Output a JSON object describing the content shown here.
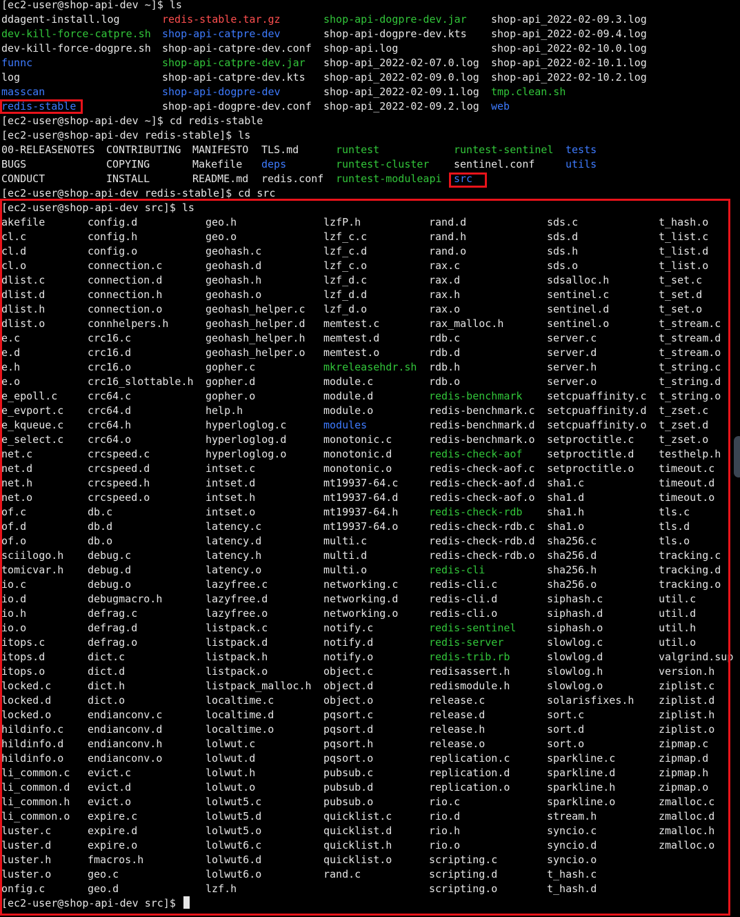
{
  "colors": {
    "background": "#000000",
    "text": "#e6e6e6",
    "executable": "#32c63a",
    "directory": "#3e7bff",
    "archive": "#ff4f4f",
    "highlight": "#e8131a"
  },
  "listing1": {
    "prompt": "[ec2-user@shop-api-dev ~]$ ls",
    "rows": [
      [
        "ddagent-install.log",
        "redis-stable.tar.gz",
        "shop-api-dogpre-dev.jar",
        "shop-api_2022-02-09.3.log"
      ],
      [
        "dev-kill-force-catpre.sh",
        "shop-api-catpre-dev",
        "shop-api-dogpre-dev.kts",
        "shop-api_2022-02-09.4.log"
      ],
      [
        "dev-kill-force-dogpre.sh",
        "shop-api-catpre-dev.conf",
        "shop-api.log",
        "shop-api_2022-02-10.0.log"
      ],
      [
        "funnc",
        "shop-api-catpre-dev.jar",
        "shop-api_2022-02-07.0.log",
        "shop-api_2022-02-10.1.log"
      ],
      [
        "log",
        "shop-api-catpre-dev.kts",
        "shop-api_2022-02-09.0.log",
        "shop-api_2022-02-10.2.log"
      ],
      [
        "masscan",
        "shop-api-dogpre-dev",
        "shop-api_2022-02-09.1.log",
        "tmp.clean.sh"
      ],
      [
        "redis-stable",
        "shop-api-dogpre-dev.conf",
        "shop-api_2022-02-09.2.log",
        "web"
      ]
    ],
    "types": [
      [
        "n",
        "a",
        "e",
        "n"
      ],
      [
        "e",
        "d",
        "n",
        "n"
      ],
      [
        "n",
        "n",
        "n",
        "n"
      ],
      [
        "d",
        "e",
        "n",
        "n"
      ],
      [
        "n",
        "n",
        "n",
        "n"
      ],
      [
        "d",
        "d",
        "n",
        "e"
      ],
      [
        "d",
        "n",
        "n",
        "d"
      ]
    ]
  },
  "cmd_cd1": "[ec2-user@shop-api-dev ~]$ cd redis-stable",
  "listing2": {
    "prompt": "[ec2-user@shop-api-dev redis-stable]$ ls",
    "rows": [
      [
        "00-RELEASENOTES",
        "CONTRIBUTING",
        "MANIFESTO",
        "TLS.md",
        "runtest",
        "runtest-sentinel",
        "tests"
      ],
      [
        "BUGS",
        "COPYING",
        "Makefile",
        "deps",
        "runtest-cluster",
        "sentinel.conf",
        "utils"
      ],
      [
        "CONDUCT",
        "INSTALL",
        "README.md",
        "redis.conf",
        "runtest-moduleapi",
        "src",
        ""
      ]
    ],
    "types": [
      [
        "n",
        "n",
        "n",
        "n",
        "e",
        "e",
        "d"
      ],
      [
        "n",
        "n",
        "n",
        "d",
        "e",
        "n",
        "d"
      ],
      [
        "n",
        "n",
        "n",
        "n",
        "e",
        "d",
        "n"
      ]
    ]
  },
  "cmd_cd2": "[ec2-user@shop-api-dev redis-stable]$ cd src",
  "listing3": {
    "prompt": "[ec2-user@shop-api-dev src]$ ls",
    "rows": [
      [
        "Makefile",
        "config.d",
        "geo.h",
        "lzfP.h",
        "rand.d",
        "sds.c",
        "t_hash.o"
      ],
      [
        "acl.c",
        "config.h",
        "geo.o",
        "lzf_c.c",
        "rand.h",
        "sds.d",
        "t_list.c"
      ],
      [
        "acl.d",
        "config.o",
        "geohash.c",
        "lzf_c.d",
        "rand.o",
        "sds.h",
        "t_list.d"
      ],
      [
        "acl.o",
        "connection.c",
        "geohash.d",
        "lzf_c.o",
        "rax.c",
        "sds.o",
        "t_list.o"
      ],
      [
        "adlist.c",
        "connection.d",
        "geohash.h",
        "lzf_d.c",
        "rax.d",
        "sdsalloc.h",
        "t_set.c"
      ],
      [
        "adlist.d",
        "connection.h",
        "geohash.o",
        "lzf_d.d",
        "rax.h",
        "sentinel.c",
        "t_set.d"
      ],
      [
        "adlist.h",
        "connection.o",
        "geohash_helper.c",
        "lzf_d.o",
        "rax.o",
        "sentinel.d",
        "t_set.o"
      ],
      [
        "adlist.o",
        "connhelpers.h",
        "geohash_helper.d",
        "memtest.c",
        "rax_malloc.h",
        "sentinel.o",
        "t_stream.c"
      ],
      [
        "ae.c",
        "crc16.c",
        "geohash_helper.h",
        "memtest.d",
        "rdb.c",
        "server.c",
        "t_stream.d"
      ],
      [
        "ae.d",
        "crc16.d",
        "geohash_helper.o",
        "memtest.o",
        "rdb.d",
        "server.d",
        "t_stream.o"
      ],
      [
        "ae.h",
        "crc16.o",
        "gopher.c",
        "mkreleasehdr.sh",
        "rdb.h",
        "server.h",
        "t_string.c"
      ],
      [
        "ae.o",
        "crc16_slottable.h",
        "gopher.d",
        "module.c",
        "rdb.o",
        "server.o",
        "t_string.d"
      ],
      [
        "ae_epoll.c",
        "crc64.c",
        "gopher.o",
        "module.d",
        "redis-benchmark",
        "setcpuaffinity.c",
        "t_string.o"
      ],
      [
        "ae_evport.c",
        "crc64.d",
        "help.h",
        "module.o",
        "redis-benchmark.c",
        "setcpuaffinity.d",
        "t_zset.c"
      ],
      [
        "ae_kqueue.c",
        "crc64.h",
        "hyperloglog.c",
        "modules",
        "redis-benchmark.d",
        "setcpuaffinity.o",
        "t_zset.d"
      ],
      [
        "ae_select.c",
        "crc64.o",
        "hyperloglog.d",
        "monotonic.c",
        "redis-benchmark.o",
        "setproctitle.c",
        "t_zset.o"
      ],
      [
        "anet.c",
        "crcspeed.c",
        "hyperloglog.o",
        "monotonic.d",
        "redis-check-aof",
        "setproctitle.d",
        "testhelp.h"
      ],
      [
        "anet.d",
        "crcspeed.d",
        "intset.c",
        "monotonic.o",
        "redis-check-aof.c",
        "setproctitle.o",
        "timeout.c"
      ],
      [
        "anet.h",
        "crcspeed.h",
        "intset.d",
        "mt19937-64.c",
        "redis-check-aof.d",
        "sha1.c",
        "timeout.d"
      ],
      [
        "anet.o",
        "crcspeed.o",
        "intset.h",
        "mt19937-64.d",
        "redis-check-aof.o",
        "sha1.d",
        "timeout.o"
      ],
      [
        "aof.c",
        "db.c",
        "intset.o",
        "mt19937-64.h",
        "redis-check-rdb",
        "sha1.h",
        "tls.c"
      ],
      [
        "aof.d",
        "db.d",
        "latency.c",
        "mt19937-64.o",
        "redis-check-rdb.c",
        "sha1.o",
        "tls.d"
      ],
      [
        "aof.o",
        "db.o",
        "latency.d",
        "multi.c",
        "redis-check-rdb.d",
        "sha256.c",
        "tls.o"
      ],
      [
        "asciilogo.h",
        "debug.c",
        "latency.h",
        "multi.d",
        "redis-check-rdb.o",
        "sha256.d",
        "tracking.c"
      ],
      [
        "atomicvar.h",
        "debug.d",
        "latency.o",
        "multi.o",
        "redis-cli",
        "sha256.h",
        "tracking.d"
      ],
      [
        "bio.c",
        "debug.o",
        "lazyfree.c",
        "networking.c",
        "redis-cli.c",
        "sha256.o",
        "tracking.o"
      ],
      [
        "bio.d",
        "debugmacro.h",
        "lazyfree.d",
        "networking.d",
        "redis-cli.d",
        "siphash.c",
        "util.c"
      ],
      [
        "bio.h",
        "defrag.c",
        "lazyfree.o",
        "networking.o",
        "redis-cli.o",
        "siphash.d",
        "util.d"
      ],
      [
        "bio.o",
        "defrag.d",
        "listpack.c",
        "notify.c",
        "redis-sentinel",
        "siphash.o",
        "util.h"
      ],
      [
        "bitops.c",
        "defrag.o",
        "listpack.d",
        "notify.d",
        "redis-server",
        "slowlog.c",
        "util.o"
      ],
      [
        "bitops.d",
        "dict.c",
        "listpack.h",
        "notify.o",
        "redis-trib.rb",
        "slowlog.d",
        "valgrind.sup"
      ],
      [
        "bitops.o",
        "dict.d",
        "listpack.o",
        "object.c",
        "redisassert.h",
        "slowlog.h",
        "version.h"
      ],
      [
        "blocked.c",
        "dict.h",
        "listpack_malloc.h",
        "object.d",
        "redismodule.h",
        "slowlog.o",
        "ziplist.c"
      ],
      [
        "blocked.d",
        "dict.o",
        "localtime.c",
        "object.o",
        "release.c",
        "solarisfixes.h",
        "ziplist.d"
      ],
      [
        "blocked.o",
        "endianconv.c",
        "localtime.d",
        "pqsort.c",
        "release.d",
        "sort.c",
        "ziplist.h"
      ],
      [
        "childinfo.c",
        "endianconv.d",
        "localtime.o",
        "pqsort.d",
        "release.h",
        "sort.d",
        "ziplist.o"
      ],
      [
        "childinfo.d",
        "endianconv.h",
        "lolwut.c",
        "pqsort.h",
        "release.o",
        "sort.o",
        "zipmap.c"
      ],
      [
        "childinfo.o",
        "endianconv.o",
        "lolwut.d",
        "pqsort.o",
        "replication.c",
        "sparkline.c",
        "zipmap.d"
      ],
      [
        "cli_common.c",
        "evict.c",
        "lolwut.h",
        "pubsub.c",
        "replication.d",
        "sparkline.d",
        "zipmap.h"
      ],
      [
        "cli_common.d",
        "evict.d",
        "lolwut.o",
        "pubsub.d",
        "replication.o",
        "sparkline.h",
        "zipmap.o"
      ],
      [
        "cli_common.h",
        "evict.o",
        "lolwut5.c",
        "pubsub.o",
        "rio.c",
        "sparkline.o",
        "zmalloc.c"
      ],
      [
        "cli_common.o",
        "expire.c",
        "lolwut5.d",
        "quicklist.c",
        "rio.d",
        "stream.h",
        "zmalloc.d"
      ],
      [
        "cluster.c",
        "expire.d",
        "lolwut5.o",
        "quicklist.d",
        "rio.h",
        "syncio.c",
        "zmalloc.h"
      ],
      [
        "cluster.d",
        "expire.o",
        "lolwut6.c",
        "quicklist.h",
        "rio.o",
        "syncio.d",
        "zmalloc.o"
      ],
      [
        "cluster.h",
        "fmacros.h",
        "lolwut6.d",
        "quicklist.o",
        "scripting.c",
        "syncio.o",
        ""
      ],
      [
        "cluster.o",
        "geo.c",
        "lolwut6.o",
        "rand.c",
        "scripting.d",
        "t_hash.c",
        ""
      ],
      [
        "config.c",
        "geo.d",
        "lzf.h",
        "",
        "scripting.o",
        "t_hash.d",
        ""
      ]
    ],
    "executables": [
      "mkreleasehdr.sh",
      "redis-benchmark",
      "redis-check-aof",
      "redis-check-rdb",
      "redis-cli",
      "redis-sentinel",
      "redis-server",
      "redis-trib.rb"
    ],
    "directories": [
      "modules"
    ]
  },
  "final_prompt": "[ec2-user@shop-api-dev src]$ "
}
